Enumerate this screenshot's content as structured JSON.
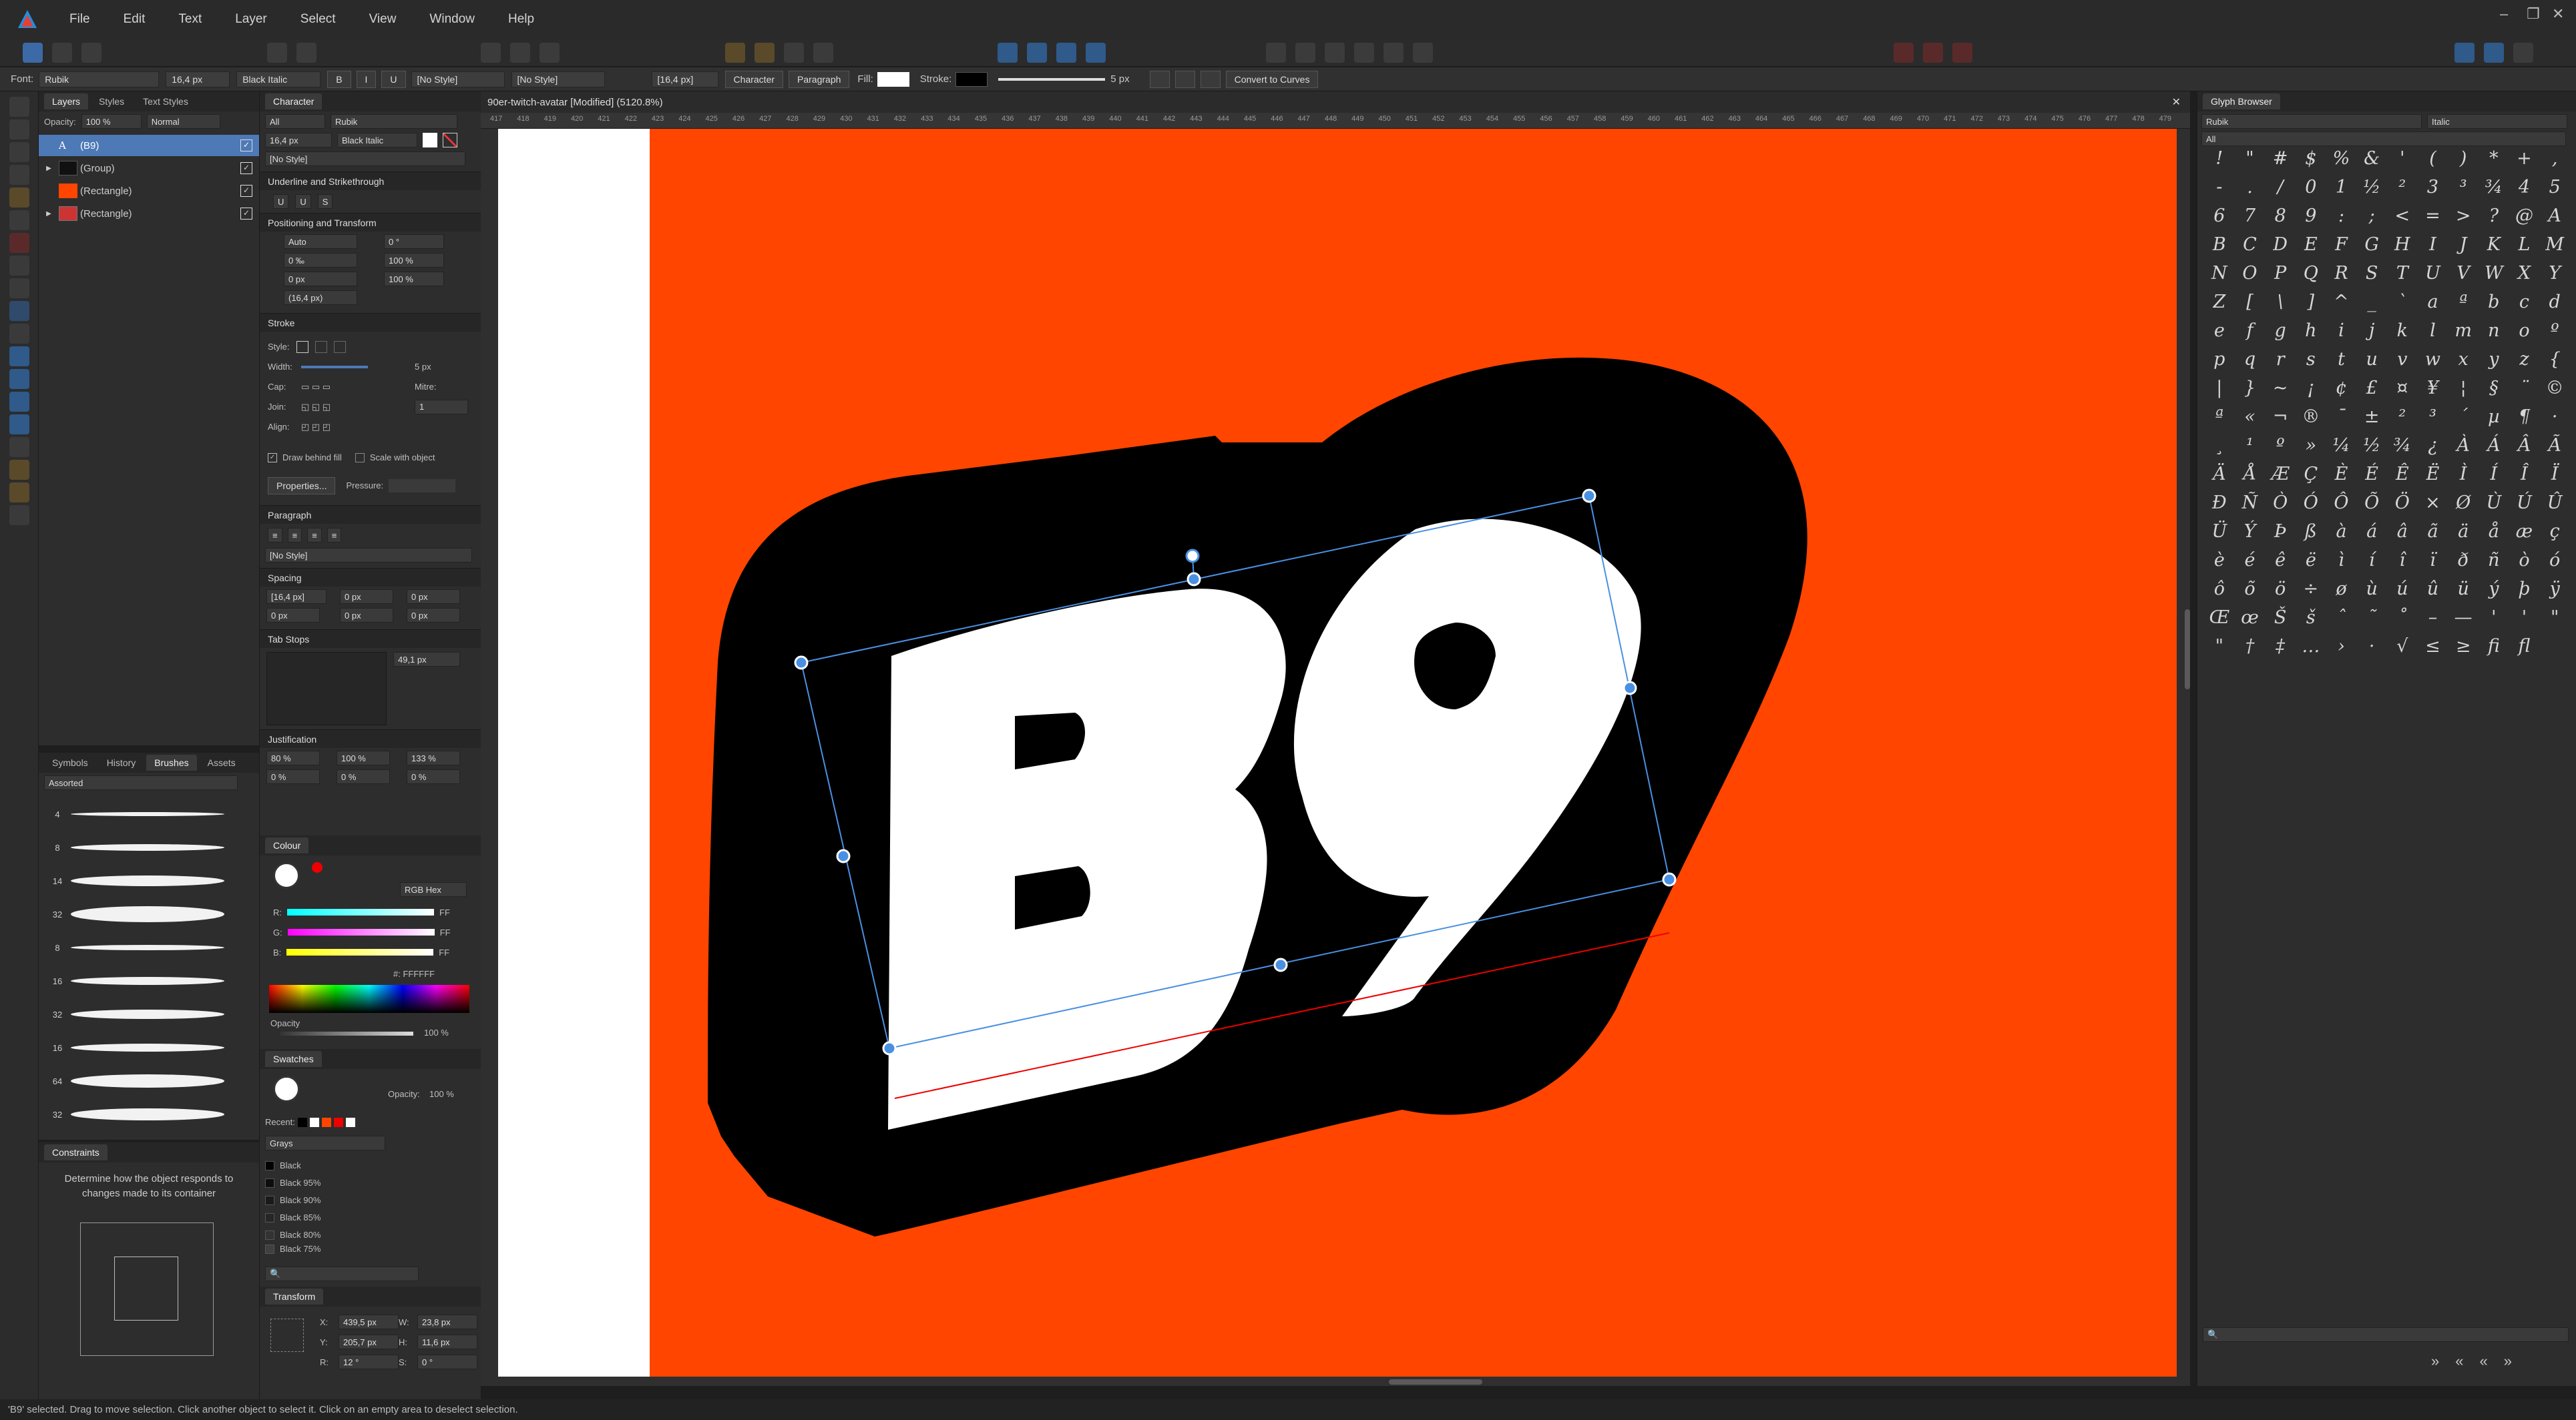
{
  "menu": {
    "items": [
      "File",
      "Edit",
      "Text",
      "Layer",
      "Select",
      "View",
      "Window",
      "Help"
    ]
  },
  "context_bar": {
    "font_label": "Font:",
    "font_family": "Rubik",
    "font_size": "16,4 px",
    "font_style": "Black Italic",
    "bold": "B",
    "italic": "I",
    "underline": "U",
    "char_style": "[No Style]",
    "para_style": "[No Style]",
    "leading": "[16,4 px]",
    "character_btn": "Character",
    "paragraph_btn": "Paragraph",
    "fill_label": "Fill:",
    "stroke_label": "Stroke:",
    "stroke_width": "5 px",
    "convert_btn": "Convert to Curves"
  },
  "layers_panel": {
    "tabs": [
      "Layers",
      "Styles",
      "Text Styles"
    ],
    "opacity_label": "Opacity:",
    "opacity_value": "100 %",
    "blend_mode": "Normal",
    "rows": [
      {
        "name": "(B9)",
        "selected": true
      },
      {
        "name": "(Group)",
        "selected": false
      },
      {
        "name": "(Rectangle)",
        "selected": false
      },
      {
        "name": "(Rectangle)",
        "selected": false
      }
    ]
  },
  "brushes_panel": {
    "tabs": [
      "Symbols",
      "History",
      "Brushes",
      "Assets"
    ],
    "category": "Assorted",
    "sizes": [
      "4",
      "8",
      "14",
      "32",
      "8",
      "16",
      "32",
      "16",
      "64",
      "32"
    ]
  },
  "constraints_panel": {
    "title": "Constraints",
    "description": "Determine how the object responds to changes made to its container"
  },
  "character_panel": {
    "title": "Character",
    "font_collection": "All",
    "font_family": "Rubik",
    "size": "16,4 px",
    "style": "Black Italic",
    "no_style": "[No Style]",
    "underline_section": "Underline and Strikethrough",
    "positioning_section": "Positioning and Transform",
    "kerning": "Auto",
    "shear": "0 °",
    "tracking": "0 ‰",
    "vscale": "100 %",
    "baseline": "0 px",
    "hscale": "100 %",
    "leading": "(16,4 px)"
  },
  "stroke_panel": {
    "title": "Stroke",
    "style_label": "Style:",
    "width_label": "Width:",
    "width_value": "5 px",
    "cap_label": "Cap:",
    "mitre_label": "Mitre:",
    "join_label": "Join:",
    "mitre_value": "1",
    "align_label": "Align:",
    "draw_behind": "Draw behind fill",
    "scale_with": "Scale with object",
    "properties_btn": "Properties...",
    "pressure_label": "Pressure:"
  },
  "paragraph_panel": {
    "title": "Paragraph",
    "no_style": "[No Style]",
    "spacing_section": "Spacing",
    "leading": "[16,4 px]",
    "space_before": "0 px",
    "space_after": "0 px",
    "indent_left": "0 px",
    "indent_first": "0 px",
    "indent_right": "0 px",
    "tab_stops_section": "Tab Stops",
    "tab_value": "49,1 px",
    "justification_section": "Justification",
    "word_min": "80 %",
    "word_desired": "100 %",
    "word_max": "133 %",
    "letter_min": "0 %",
    "letter_desired": "0 %",
    "letter_max": "0 %"
  },
  "colour_panel": {
    "title": "Colour",
    "mode": "RGB Hex",
    "r_label": "R:",
    "g_label": "G:",
    "b_label": "B:",
    "r_value": "FF",
    "g_value": "FF",
    "b_value": "FF",
    "hex": "#: FFFFFF",
    "opacity_label": "Opacity",
    "opacity_value": "100 %"
  },
  "swatches_panel": {
    "title": "Swatches",
    "opacity_label": "Opacity:",
    "opacity_value": "100 %",
    "recent_label": "Recent:",
    "palette": "Grays",
    "items": [
      "Black",
      "Black 95%",
      "Black 90%",
      "Black 85%",
      "Black 80%",
      "Black 75%"
    ]
  },
  "transform_panel": {
    "title": "Transform",
    "x_label": "X:",
    "x": "439,5 px",
    "w_label": "W:",
    "w": "23,8 px",
    "y_label": "Y:",
    "y": "205,7 px",
    "h_label": "H:",
    "h": "11,6 px",
    "r_label": "R:",
    "r": "12 °",
    "s_label": "S:",
    "s": "0 °"
  },
  "document": {
    "tab_title": "90er-twitch-avatar [Modified] (5120.8%)",
    "ruler_ticks": [
      "417",
      "418",
      "419",
      "420",
      "421",
      "422",
      "423",
      "424",
      "425",
      "426",
      "427",
      "428",
      "429",
      "430",
      "431",
      "432",
      "433",
      "434",
      "435",
      "436",
      "437",
      "438",
      "439",
      "440",
      "441",
      "442",
      "443",
      "444",
      "445",
      "446",
      "447",
      "448",
      "449",
      "450",
      "451",
      "452",
      "453",
      "454",
      "455",
      "456",
      "457",
      "458",
      "459",
      "460",
      "461",
      "462",
      "463",
      "464",
      "465",
      "466",
      "467",
      "468",
      "469",
      "470",
      "471",
      "472",
      "473",
      "474",
      "475",
      "476",
      "477",
      "478",
      "479"
    ],
    "artwork_text": "B9",
    "background_color": "#ff4500",
    "badge_color": "#000000",
    "text_color": "#ffffff"
  },
  "glyph_browser": {
    "title": "Glyph Browser",
    "font": "Rubik",
    "style": "Italic",
    "range": "All",
    "glyphs": [
      "!",
      "\"",
      "#",
      "$",
      "%",
      "&",
      "'",
      "(",
      ")",
      "*",
      "+",
      ",",
      "-",
      ".",
      "/",
      "0",
      "1",
      "½",
      "²",
      "3",
      "³",
      "¾",
      "4",
      "5",
      "6",
      "7",
      "8",
      "9",
      ":",
      ";",
      "<",
      "=",
      ">",
      "?",
      "@",
      "A",
      "B",
      "C",
      "D",
      "E",
      "F",
      "G",
      "H",
      "I",
      "J",
      "K",
      "L",
      "M",
      "N",
      "O",
      "P",
      "Q",
      "R",
      "S",
      "T",
      "U",
      "V",
      "W",
      "X",
      "Y",
      "Z",
      "[",
      "\\",
      "]",
      "^",
      "_",
      "`",
      "a",
      "ª",
      "b",
      "c",
      "d",
      "e",
      "f",
      "g",
      "h",
      "i",
      "j",
      "k",
      "l",
      "m",
      "n",
      "o",
      "º",
      "p",
      "q",
      "r",
      "s",
      "t",
      "u",
      "v",
      "w",
      "x",
      "y",
      "z",
      "{",
      "|",
      "}",
      "~",
      "¡",
      "¢",
      "£",
      "¤",
      "¥",
      "¦",
      "§",
      "¨",
      "©",
      "ª",
      "«",
      "¬",
      "®",
      "¯",
      "±",
      "²",
      "³",
      "´",
      "µ",
      "¶",
      "·",
      "¸",
      "¹",
      "º",
      "»",
      "¼",
      "½",
      "¾",
      "¿",
      "À",
      "Á",
      "Â",
      "Ã",
      "Ä",
      "Å",
      "Æ",
      "Ç",
      "È",
      "É",
      "Ê",
      "Ë",
      "Ì",
      "Í",
      "Î",
      "Ï",
      "Ð",
      "Ñ",
      "Ò",
      "Ó",
      "Ô",
      "Õ",
      "Ö",
      "×",
      "Ø",
      "Ù",
      "Ú",
      "Û",
      "Ü",
      "Ý",
      "Þ",
      "ß",
      "à",
      "á",
      "â",
      "ã",
      "ä",
      "å",
      "æ",
      "ç",
      "è",
      "é",
      "ê",
      "ë",
      "ì",
      "í",
      "î",
      "ï",
      "ð",
      "ñ",
      "ò",
      "ó",
      "ô",
      "õ",
      "ö",
      "÷",
      "ø",
      "ù",
      "ú",
      "û",
      "ü",
      "ý",
      "þ",
      "ÿ",
      "Œ",
      "œ",
      "Š",
      "š",
      "ˆ",
      "˜",
      "˚",
      "–",
      "—",
      "'",
      "'",
      "\"",
      "\"",
      "†",
      "‡",
      "…",
      "›",
      "·",
      "√",
      "≤",
      "≥",
      "fi",
      "fl"
    ],
    "nav_buttons": [
      "»",
      "«",
      "«",
      "»"
    ]
  },
  "status": {
    "text": "'B9' selected. Drag to move selection. Click another object to select it. Click on an empty area to deselect selection."
  }
}
